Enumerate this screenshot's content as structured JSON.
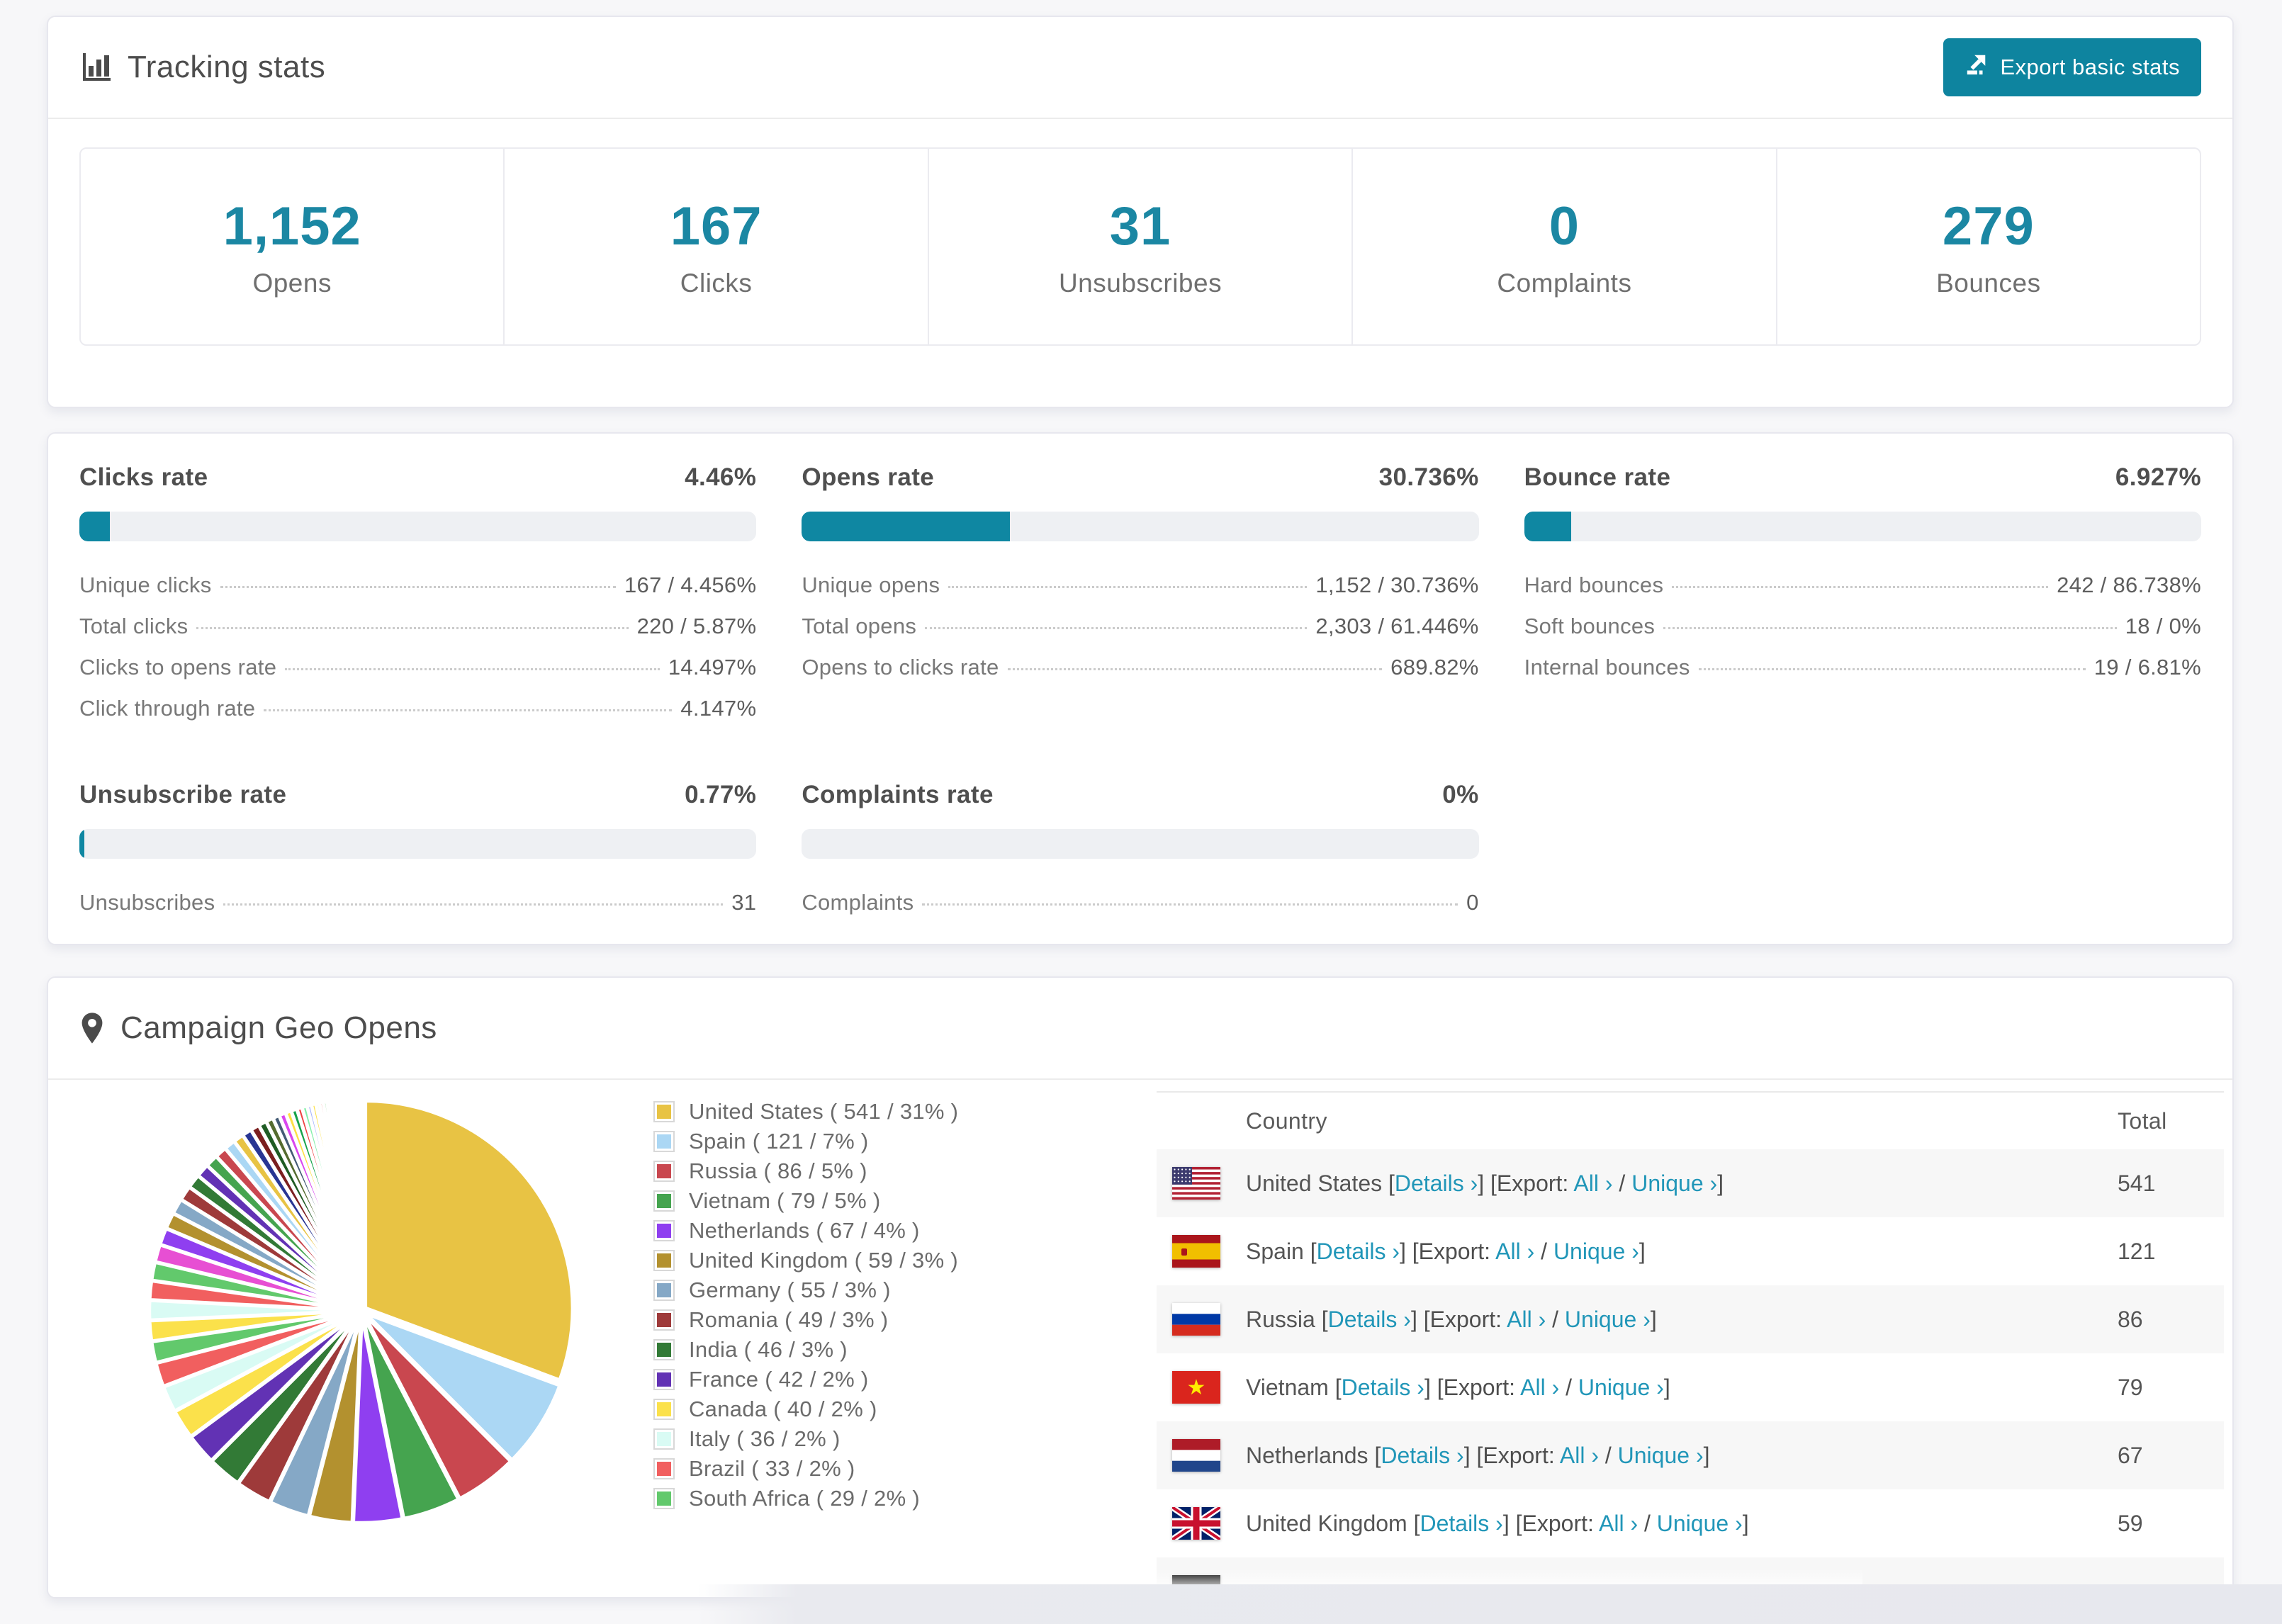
{
  "colors": {
    "accent": "#1b87a3",
    "button": "#0e849f",
    "link": "#2196b8",
    "bar_track": "#eef0f3",
    "bar_fill": "#0f87a2"
  },
  "tracking": {
    "title": "Tracking stats",
    "icon": "bar-chart-icon",
    "export_button_label": "Export basic stats",
    "stats": [
      {
        "value": "1,152",
        "label": "Opens"
      },
      {
        "value": "167",
        "label": "Clicks"
      },
      {
        "value": "31",
        "label": "Unsubscribes"
      },
      {
        "value": "0",
        "label": "Complaints"
      },
      {
        "value": "279",
        "label": "Bounces"
      }
    ]
  },
  "rates": {
    "sections": [
      {
        "id": "clicks",
        "title": "Clicks rate",
        "value": "4.46%",
        "progress_pct": 4.46,
        "rows": [
          {
            "label": "Unique clicks",
            "value": "167 / 4.456%"
          },
          {
            "label": "Total clicks",
            "value": "220 / 5.87%"
          },
          {
            "label": "Clicks to opens rate",
            "value": "14.497%"
          },
          {
            "label": "Click through rate",
            "value": "4.147%"
          }
        ]
      },
      {
        "id": "opens",
        "title": "Opens rate",
        "value": "30.736%",
        "progress_pct": 30.736,
        "rows": [
          {
            "label": "Unique opens",
            "value": "1,152 / 30.736%"
          },
          {
            "label": "Total opens",
            "value": "2,303 / 61.446%"
          },
          {
            "label": "Opens to clicks rate",
            "value": "689.82%"
          }
        ]
      },
      {
        "id": "bounce",
        "title": "Bounce rate",
        "value": "6.927%",
        "progress_pct": 6.927,
        "rows": [
          {
            "label": "Hard bounces",
            "value": "242 / 86.738%"
          },
          {
            "label": "Soft bounces",
            "value": "18 / 0%"
          },
          {
            "label": "Internal bounces",
            "value": "19 / 6.81%"
          }
        ]
      },
      {
        "id": "unsubscribe",
        "title": "Unsubscribe rate",
        "value": "0.77%",
        "progress_pct": 0.77,
        "rows": [
          {
            "label": "Unsubscribes",
            "value": "31"
          }
        ]
      },
      {
        "id": "complaints",
        "title": "Complaints rate",
        "value": "0%",
        "progress_pct": 0,
        "rows": [
          {
            "label": "Complaints",
            "value": "0"
          }
        ]
      }
    ]
  },
  "geo": {
    "title": "Campaign Geo Opens",
    "icon": "map-pin-icon",
    "chart_data": {
      "type": "pie",
      "title": "Campaign Geo Opens",
      "labels": [
        "United States",
        "Spain",
        "Russia",
        "Vietnam",
        "Netherlands",
        "United Kingdom",
        "Germany",
        "Romania",
        "India",
        "France",
        "Canada",
        "Italy",
        "Brazil",
        "South Africa"
      ],
      "values": [
        541,
        121,
        86,
        79,
        67,
        59,
        55,
        49,
        46,
        42,
        40,
        36,
        33,
        29
      ],
      "percent_labels": [
        "31%",
        "7%",
        "5%",
        "5%",
        "4%",
        "3%",
        "3%",
        "3%",
        "3%",
        "2%",
        "2%",
        "2%",
        "2%",
        "2%"
      ],
      "colors": [
        "#e8c344",
        "#abd7f4",
        "#c9474f",
        "#45a44f",
        "#8f3ff0",
        "#b3912f",
        "#85a8c6",
        "#9e3a3a",
        "#327a36",
        "#6232b4",
        "#fbe14b",
        "#d9fbf4",
        "#f15f5f",
        "#62c96c"
      ],
      "unlabeled_tail_values": [
        28,
        27,
        26,
        25,
        24,
        23,
        22,
        21,
        20,
        19,
        18,
        17,
        16,
        15,
        14,
        13,
        12,
        11,
        10,
        9,
        9,
        8,
        8,
        7,
        7,
        6,
        6,
        5,
        5,
        5,
        4,
        4,
        4,
        3,
        3,
        3,
        3,
        2,
        2,
        2,
        2,
        2,
        2,
        1,
        1,
        1,
        1,
        1,
        1,
        1,
        1,
        1,
        1
      ],
      "tail_palette": [
        "#fbe14b",
        "#d9fbf4",
        "#f15f5f",
        "#62c96c",
        "#e74fd3",
        "#8f3ff0",
        "#b3912f",
        "#85a8c6",
        "#9e3a3a",
        "#327a36",
        "#6232b4",
        "#45a44f",
        "#c9474f",
        "#abd7f4",
        "#e8c344",
        "#283593",
        "#7b1f1f",
        "#1f5c24",
        "#556b2f",
        "#445b75",
        "#d946ef",
        "#fde047",
        "#16a34a",
        "#ef4444",
        "#86efac",
        "#a5b4fc"
      ],
      "start_angle_deg": 0,
      "direction": "clockwise",
      "legend_position": "right",
      "legend_format": "{label} ( {value} / {pct} )"
    },
    "table": {
      "headers": [
        "Country",
        "Total"
      ],
      "row_links": {
        "details": "Details ›",
        "export_prefix": "Export:",
        "all": "All ›",
        "unique": "Unique ›"
      },
      "rows": [
        {
          "country": "United States",
          "flag": "us",
          "total": "541",
          "partial": false
        },
        {
          "country": "Spain",
          "flag": "es",
          "total": "121",
          "partial": false
        },
        {
          "country": "Russia",
          "flag": "ru",
          "total": "86",
          "partial": false
        },
        {
          "country": "Vietnam",
          "flag": "vn",
          "total": "79",
          "partial": false
        },
        {
          "country": "Netherlands",
          "flag": "nl",
          "total": "67",
          "partial": false
        },
        {
          "country": "United Kingdom",
          "flag": "gb",
          "total": "59",
          "partial": false
        },
        {
          "country": "",
          "flag": "de",
          "total": "",
          "partial": true
        }
      ]
    }
  }
}
